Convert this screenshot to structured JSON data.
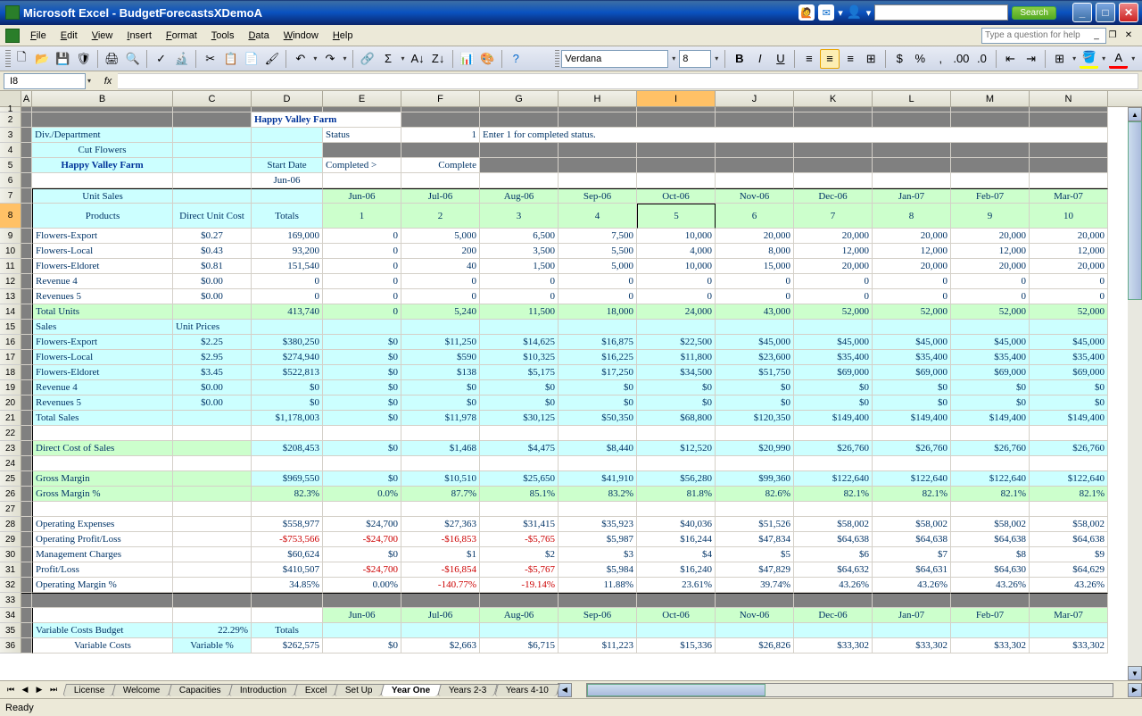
{
  "window": {
    "title": "Microsoft Excel - BudgetForecastsXDemoA",
    "search_btn": "Search",
    "help_placeholder": "Type a question for help"
  },
  "menu": [
    "File",
    "Edit",
    "View",
    "Insert",
    "Format",
    "Tools",
    "Data",
    "Window",
    "Help"
  ],
  "toolbar": {
    "font_name": "Verdana",
    "font_size": "8"
  },
  "name_box": "I8",
  "fx": "fx",
  "cols": [
    "A",
    "B",
    "C",
    "D",
    "E",
    "F",
    "G",
    "H",
    "I",
    "J",
    "K",
    "L",
    "M",
    "N"
  ],
  "active_col": "I",
  "active_row": "8",
  "row_nums": [
    1,
    2,
    3,
    4,
    5,
    6,
    7,
    8,
    9,
    10,
    11,
    12,
    13,
    14,
    15,
    16,
    17,
    18,
    19,
    20,
    21,
    22,
    23,
    24,
    25,
    26,
    27,
    28,
    29,
    30,
    31,
    32,
    33,
    34,
    35,
    36
  ],
  "r2": {
    "title": "Happy Valley Farm"
  },
  "r3": {
    "b": "Div./Department",
    "e": "Status",
    "f": "1",
    "g": "Enter 1 for completed status."
  },
  "r4": {
    "b": "Cut Flowers"
  },
  "r5": {
    "b": "Happy Valley Farm",
    "d": "Start Date",
    "e": "Completed >",
    "f": "Complete"
  },
  "r6": {
    "d": "Jun-06"
  },
  "r7": {
    "b": "Unit Sales",
    "months": [
      "Jun-06",
      "Jul-06",
      "Aug-06",
      "Sep-06",
      "Oct-06",
      "Nov-06",
      "Dec-06",
      "Jan-07",
      "Feb-07",
      "Mar-07"
    ]
  },
  "r8": {
    "b": "Products",
    "c": "Direct Unit Cost",
    "d": "Totals",
    "nums": [
      "1",
      "2",
      "3",
      "4",
      "5",
      "6",
      "7",
      "8",
      "9",
      "10"
    ]
  },
  "units": [
    {
      "b": "Flowers-Export",
      "c": "$0.27",
      "d": "169,000",
      "v": [
        "0",
        "5,000",
        "6,500",
        "7,500",
        "10,000",
        "20,000",
        "20,000",
        "20,000",
        "20,000",
        "20,000"
      ]
    },
    {
      "b": "Flowers-Local",
      "c": "$0.43",
      "d": "93,200",
      "v": [
        "0",
        "200",
        "3,500",
        "5,500",
        "4,000",
        "8,000",
        "12,000",
        "12,000",
        "12,000",
        "12,000"
      ]
    },
    {
      "b": "Flowers-Eldoret",
      "c": "$0.81",
      "d": "151,540",
      "v": [
        "0",
        "40",
        "1,500",
        "5,000",
        "10,000",
        "15,000",
        "20,000",
        "20,000",
        "20,000",
        "20,000"
      ]
    },
    {
      "b": "Revenue 4",
      "c": "$0.00",
      "d": "0",
      "v": [
        "0",
        "0",
        "0",
        "0",
        "0",
        "0",
        "0",
        "0",
        "0",
        "0"
      ]
    },
    {
      "b": "Revenues 5",
      "c": "$0.00",
      "d": "0",
      "v": [
        "0",
        "0",
        "0",
        "0",
        "0",
        "0",
        "0",
        "0",
        "0",
        "0"
      ]
    }
  ],
  "total_units": {
    "b": "Total Units",
    "d": "413,740",
    "v": [
      "0",
      "5,240",
      "11,500",
      "18,000",
      "24,000",
      "43,000",
      "52,000",
      "52,000",
      "52,000",
      "52,000"
    ]
  },
  "r15": {
    "b": "Sales",
    "c": "Unit Prices"
  },
  "sales": [
    {
      "b": "Flowers-Export",
      "c": "$2.25",
      "d": "$380,250",
      "v": [
        "$0",
        "$11,250",
        "$14,625",
        "$16,875",
        "$22,500",
        "$45,000",
        "$45,000",
        "$45,000",
        "$45,000",
        "$45,000"
      ]
    },
    {
      "b": "Flowers-Local",
      "c": "$2.95",
      "d": "$274,940",
      "v": [
        "$0",
        "$590",
        "$10,325",
        "$16,225",
        "$11,800",
        "$23,600",
        "$35,400",
        "$35,400",
        "$35,400",
        "$35,400"
      ]
    },
    {
      "b": "Flowers-Eldoret",
      "c": "$3.45",
      "d": "$522,813",
      "v": [
        "$0",
        "$138",
        "$5,175",
        "$17,250",
        "$34,500",
        "$51,750",
        "$69,000",
        "$69,000",
        "$69,000",
        "$69,000"
      ]
    },
    {
      "b": "Revenue 4",
      "c": "$0.00",
      "d": "$0",
      "v": [
        "$0",
        "$0",
        "$0",
        "$0",
        "$0",
        "$0",
        "$0",
        "$0",
        "$0",
        "$0"
      ]
    },
    {
      "b": "Revenues 5",
      "c": "$0.00",
      "d": "$0",
      "v": [
        "$0",
        "$0",
        "$0",
        "$0",
        "$0",
        "$0",
        "$0",
        "$0",
        "$0",
        "$0"
      ]
    }
  ],
  "total_sales": {
    "b": "Total Sales",
    "d": "$1,178,003",
    "v": [
      "$0",
      "$11,978",
      "$30,125",
      "$50,350",
      "$68,800",
      "$120,350",
      "$149,400",
      "$149,400",
      "$149,400",
      "$149,400"
    ]
  },
  "dcos": {
    "b": "Direct Cost of Sales",
    "d": "$208,453",
    "v": [
      "$0",
      "$1,468",
      "$4,475",
      "$8,440",
      "$12,520",
      "$20,990",
      "$26,760",
      "$26,760",
      "$26,760",
      "$26,760"
    ]
  },
  "gm": {
    "b": "Gross Margin",
    "d": "$969,550",
    "v": [
      "$0",
      "$10,510",
      "$25,650",
      "$41,910",
      "$56,280",
      "$99,360",
      "$122,640",
      "$122,640",
      "$122,640",
      "$122,640"
    ]
  },
  "gmp": {
    "b": "Gross Margin %",
    "d": "82.3%",
    "v": [
      "0.0%",
      "87.7%",
      "85.1%",
      "83.2%",
      "81.8%",
      "82.6%",
      "82.1%",
      "82.1%",
      "82.1%",
      "82.1%"
    ]
  },
  "opex": {
    "b": "Operating Expenses",
    "d": "$558,977",
    "v": [
      "$24,700",
      "$27,363",
      "$31,415",
      "$35,923",
      "$40,036",
      "$51,526",
      "$58,002",
      "$58,002",
      "$58,002",
      "$58,002"
    ]
  },
  "opl": {
    "b": "Operating Profit/Loss",
    "d": "-$753,566",
    "v": [
      "-$24,700",
      "-$16,853",
      "-$5,765",
      "$5,987",
      "$16,244",
      "$47,834",
      "$64,638",
      "$64,638",
      "$64,638",
      "$64,638"
    ],
    "neg": [
      true,
      true,
      true,
      true,
      false,
      false,
      false,
      false,
      false,
      false,
      false
    ]
  },
  "mgmt": {
    "b": "Management Charges",
    "d": "$60,624",
    "v": [
      "$0",
      "$1",
      "$2",
      "$3",
      "$4",
      "$5",
      "$6",
      "$7",
      "$8",
      "$9"
    ]
  },
  "pl": {
    "b": "Profit/Loss",
    "d": "$410,507",
    "v": [
      "-$24,700",
      "-$16,854",
      "-$5,767",
      "$5,984",
      "$16,240",
      "$47,829",
      "$64,632",
      "$64,631",
      "$64,630",
      "$64,629"
    ],
    "neg": [
      false,
      true,
      true,
      true,
      false,
      false,
      false,
      false,
      false,
      false,
      false
    ]
  },
  "opm": {
    "b": "Operating Margin %",
    "d": "34.85%",
    "v": [
      "0.00%",
      "-140.77%",
      "-19.14%",
      "11.88%",
      "23.61%",
      "39.74%",
      "43.26%",
      "43.26%",
      "43.26%",
      "43.26%"
    ],
    "neg": [
      false,
      false,
      true,
      true,
      false,
      false,
      false,
      false,
      false,
      false,
      false
    ]
  },
  "r34": {
    "months": [
      "Jun-06",
      "Jul-06",
      "Aug-06",
      "Sep-06",
      "Oct-06",
      "Nov-06",
      "Dec-06",
      "Jan-07",
      "Feb-07",
      "Mar-07"
    ]
  },
  "r35": {
    "b": "Variable Costs Budget",
    "c": "22.29%",
    "d": "Totals"
  },
  "r36": {
    "b": "Variable Costs",
    "c": "Variable %",
    "d": "$262,575",
    "v": [
      "$0",
      "$2,663",
      "$6,715",
      "$11,223",
      "$15,336",
      "$26,826",
      "$33,302",
      "$33,302",
      "$33,302",
      "$33,302"
    ]
  },
  "tabs": [
    "License",
    "Welcome",
    "Capacities",
    "Introduction",
    "Excel",
    "Set Up",
    "Year One",
    "Years 2-3",
    "Years 4-10"
  ],
  "active_tab": "Year One",
  "status": "Ready"
}
